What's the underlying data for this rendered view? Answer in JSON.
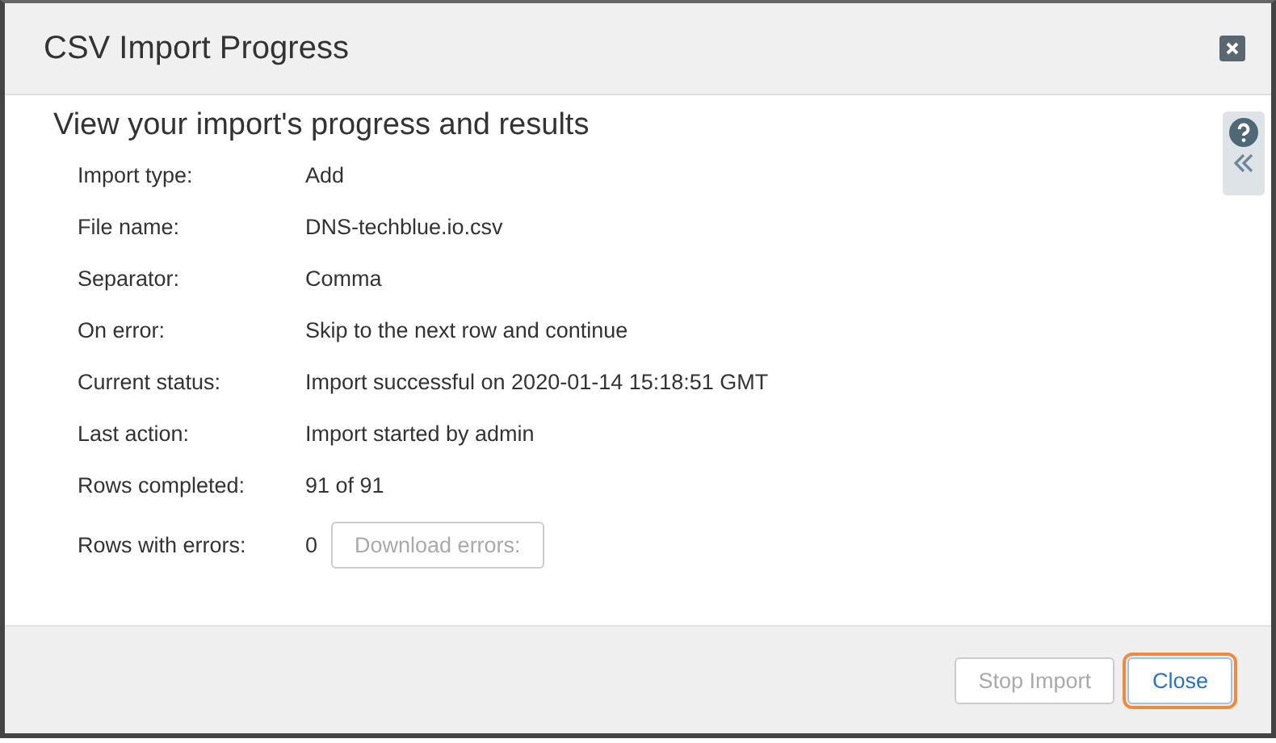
{
  "window": {
    "title": "CSV Import Progress"
  },
  "heading": "View your import's progress and results",
  "fields": [
    {
      "label": "Import type:",
      "value": "Add"
    },
    {
      "label": "File name:",
      "value": "DNS-techblue.io.csv"
    },
    {
      "label": "Separator:",
      "value": "Comma"
    },
    {
      "label": "On error:",
      "value": "Skip to the next row and continue"
    },
    {
      "label": "Current status:",
      "value": "Import successful on 2020-01-14 15:18:51 GMT"
    },
    {
      "label": "Last action:",
      "value": "Import started by admin"
    },
    {
      "label": "Rows completed:",
      "value": "91 of 91"
    },
    {
      "label": "Rows with errors:",
      "value": "0",
      "button": {
        "label": "Download errors:",
        "disabled": true
      }
    }
  ],
  "buttons": [
    {
      "label": "Stop Import",
      "disabled": true,
      "focused": false
    },
    {
      "label": "Close",
      "disabled": false,
      "focused": true
    }
  ]
}
